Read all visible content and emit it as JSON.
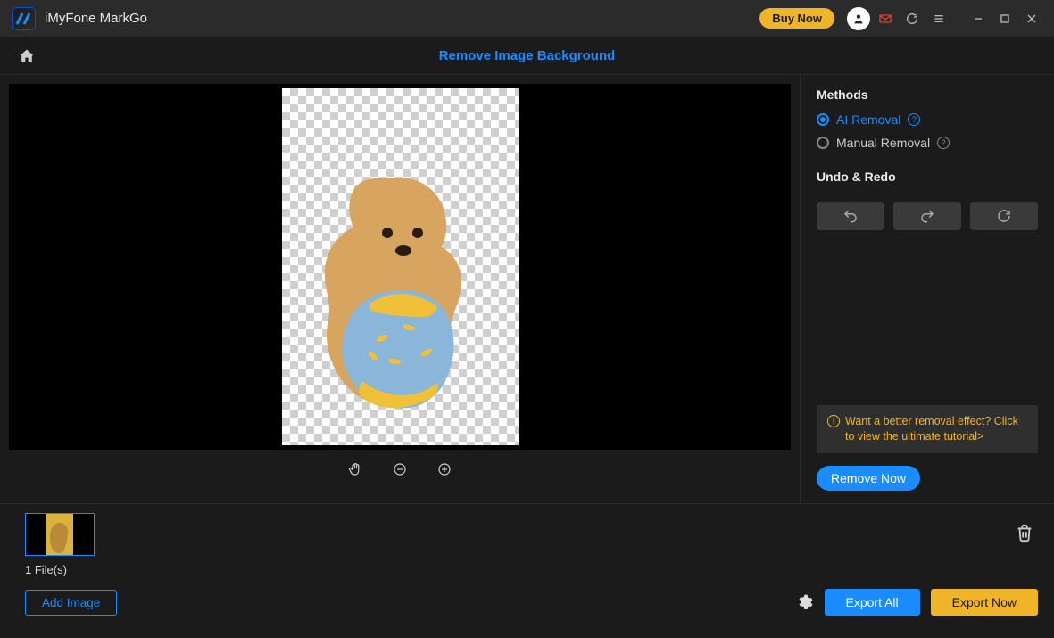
{
  "titlebar": {
    "app_name": "iMyFone MarkGo",
    "buy_label": "Buy Now"
  },
  "toolbar": {
    "title": "Remove Image Background"
  },
  "sidepanel": {
    "methods_title": "Methods",
    "ai_label": "AI Removal",
    "manual_label": "Manual Removal",
    "undo_title": "Undo & Redo",
    "hint_text": "Want a better removal effect? Click to view the ultimate tutorial>",
    "remove_now_label": "Remove Now"
  },
  "bottom": {
    "file_count_label": "1 File(s)",
    "add_image_label": "Add Image",
    "export_all_label": "Export All",
    "export_now_label": "Export Now"
  }
}
